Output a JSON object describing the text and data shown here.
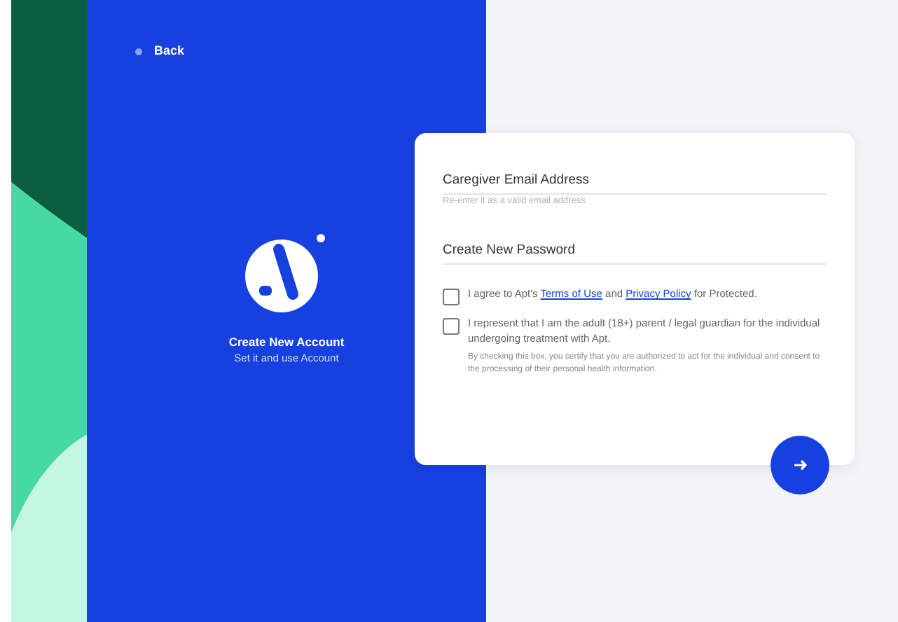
{
  "back": {
    "label": "Back"
  },
  "brand": {
    "title": "Create New Account",
    "subtitle": "Set it and use Account"
  },
  "form": {
    "fields": [
      {
        "placeholder": "Caregiver Email Address",
        "hint": "Re-enter it as a valid email address"
      },
      {
        "placeholder": "Create New Password"
      }
    ],
    "agreements": [
      {
        "checked": false,
        "parts": [
          {
            "kind": "text",
            "text": "I agree to Apt's "
          },
          {
            "kind": "link",
            "text": "Terms of Use"
          },
          {
            "kind": "text",
            "text": " and "
          },
          {
            "kind": "link",
            "text": "Privacy Policy"
          },
          {
            "kind": "text",
            "text": " for Protected."
          }
        ]
      },
      {
        "checked": false,
        "parts": [
          {
            "kind": "text",
            "text": "I represent that I am the adult (18+) parent / legal guardian for the individual undergoing treatment with Apt."
          }
        ],
        "note": "By checking this box, you certify that you are authorized to act for the individual and consent to the processing of their personal health information."
      }
    ]
  }
}
